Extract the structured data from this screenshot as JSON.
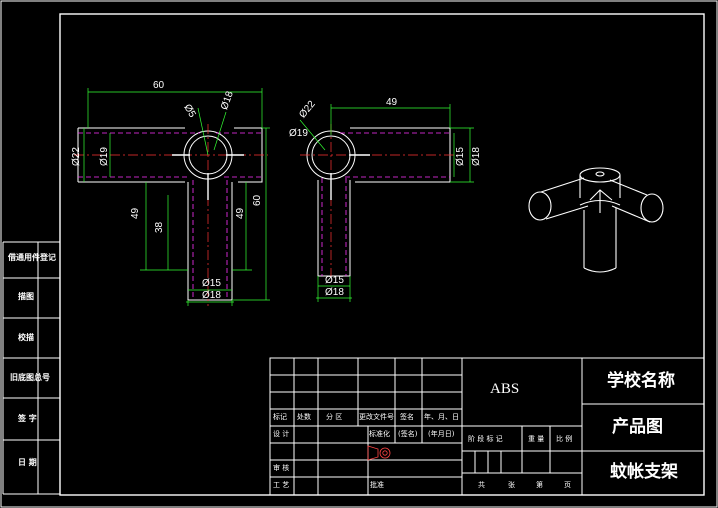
{
  "colors": {
    "background": "#000000",
    "frame": "#ffffff",
    "outline": "#ffffff",
    "hidden": "#ff33ff",
    "center": "#ff3333",
    "dimension": "#33ff33"
  },
  "side_panel": {
    "items": [
      "借通用件登记",
      "描图",
      "校描",
      "旧底图总号",
      "签  字",
      "日  期"
    ]
  },
  "title_block": {
    "material": "ABS",
    "school": "学校名称",
    "drawing_type": "产品图",
    "part_name": "蚊帐支架",
    "rev_headers": [
      "标记",
      "处数",
      "分  区",
      "更改文件号",
      "签名",
      "年、月、日"
    ],
    "roles": [
      "设  计",
      "审  核",
      "工  艺"
    ],
    "std_label": "标准化",
    "sign_label": "(签名)",
    "date_label": "(年月日)",
    "approve_label": "批准",
    "stage_headers": [
      "阶  段  标  记",
      "重  量",
      "比  例"
    ],
    "sheet_labels": [
      "共",
      "张",
      "第",
      "页"
    ]
  },
  "dimensions": {
    "left_view": [
      "60",
      "Ø5",
      "Ø18",
      "Ø22",
      "Ø19",
      "49",
      "38",
      "49",
      "60",
      "Ø15",
      "Ø18"
    ],
    "right_view": [
      "49",
      "Ø22",
      "Ø19",
      "Ø15",
      "Ø18",
      "Ø15",
      "Ø18"
    ]
  },
  "icons": {
    "projection_symbol": "first-angle-projection-icon",
    "iso_view": "isometric-bracket-icon"
  }
}
